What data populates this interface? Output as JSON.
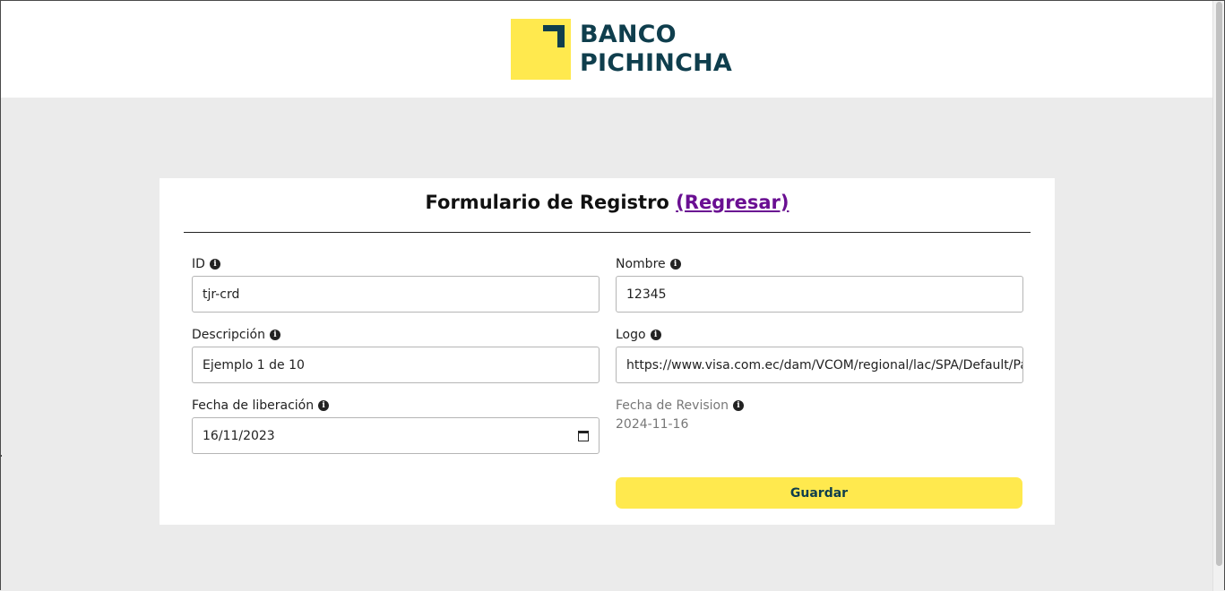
{
  "header": {
    "logo": {
      "line1": "BANCO",
      "line2": "PICHINCHA"
    }
  },
  "form": {
    "title": "Formulario de Registro",
    "back_link": "(Regresar)",
    "fields": {
      "id": {
        "label": "ID",
        "value": "tjr-crd"
      },
      "nombre": {
        "label": "Nombre",
        "value": "12345"
      },
      "descripcion": {
        "label": "Descripción",
        "value": "Ejemplo 1 de 10"
      },
      "logo": {
        "label": "Logo",
        "value": "https://www.visa.com.ec/dam/VCOM/regional/lac/SPA/Default/Pay"
      },
      "fecha_liberacion": {
        "label": "Fecha de liberación",
        "value": "16/11/2023"
      },
      "fecha_revision": {
        "label": "Fecha de Revision",
        "value": "2024-11-16"
      }
    },
    "save_label": "Guardar"
  },
  "colors": {
    "brand_yellow": "#ffe94e",
    "brand_dark": "#0f3e4d",
    "link_purple": "#6a0f92",
    "page_bg": "#ebebeb"
  },
  "icons": {
    "info": "info-circle-icon",
    "calendar": "calendar-icon"
  }
}
